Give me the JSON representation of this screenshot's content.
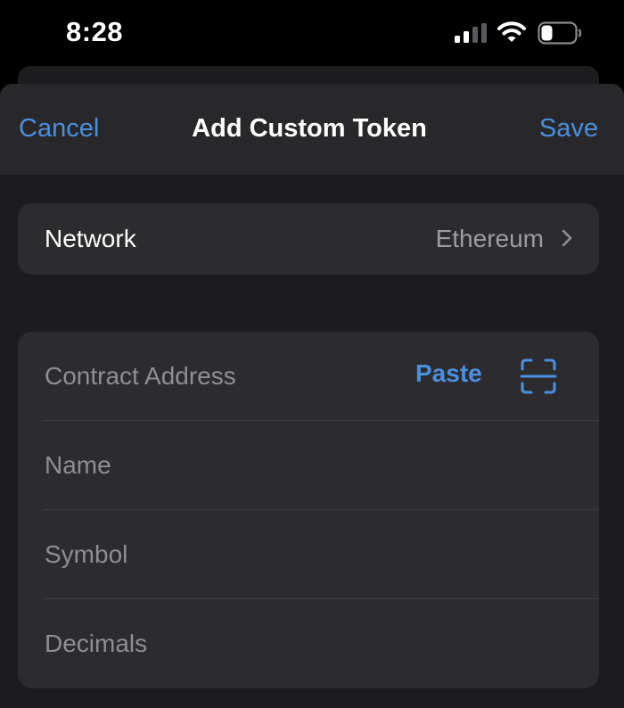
{
  "status_bar": {
    "time": "8:28",
    "icons": [
      "cellular-signal-icon",
      "wifi-icon",
      "battery-icon"
    ]
  },
  "nav": {
    "cancel_label": "Cancel",
    "title": "Add Custom Token",
    "save_label": "Save"
  },
  "network": {
    "label": "Network",
    "value": "Ethereum",
    "icon": "chevron-right-icon"
  },
  "fields": {
    "contract_address": {
      "placeholder": "Contract Address",
      "value": ""
    },
    "paste_label": "Paste",
    "scan_icon": "qr-scan-icon",
    "name": {
      "placeholder": "Name",
      "value": ""
    },
    "symbol": {
      "placeholder": "Symbol",
      "value": ""
    },
    "decimals": {
      "placeholder": "Decimals",
      "value": ""
    }
  },
  "colors": {
    "accent": "#4a8fe0",
    "background": "#000000",
    "sheet": "#1c1c1e",
    "nav_bar": "#28282a",
    "group": "#2c2c2e",
    "secondary_text": "#9c9ca3"
  }
}
